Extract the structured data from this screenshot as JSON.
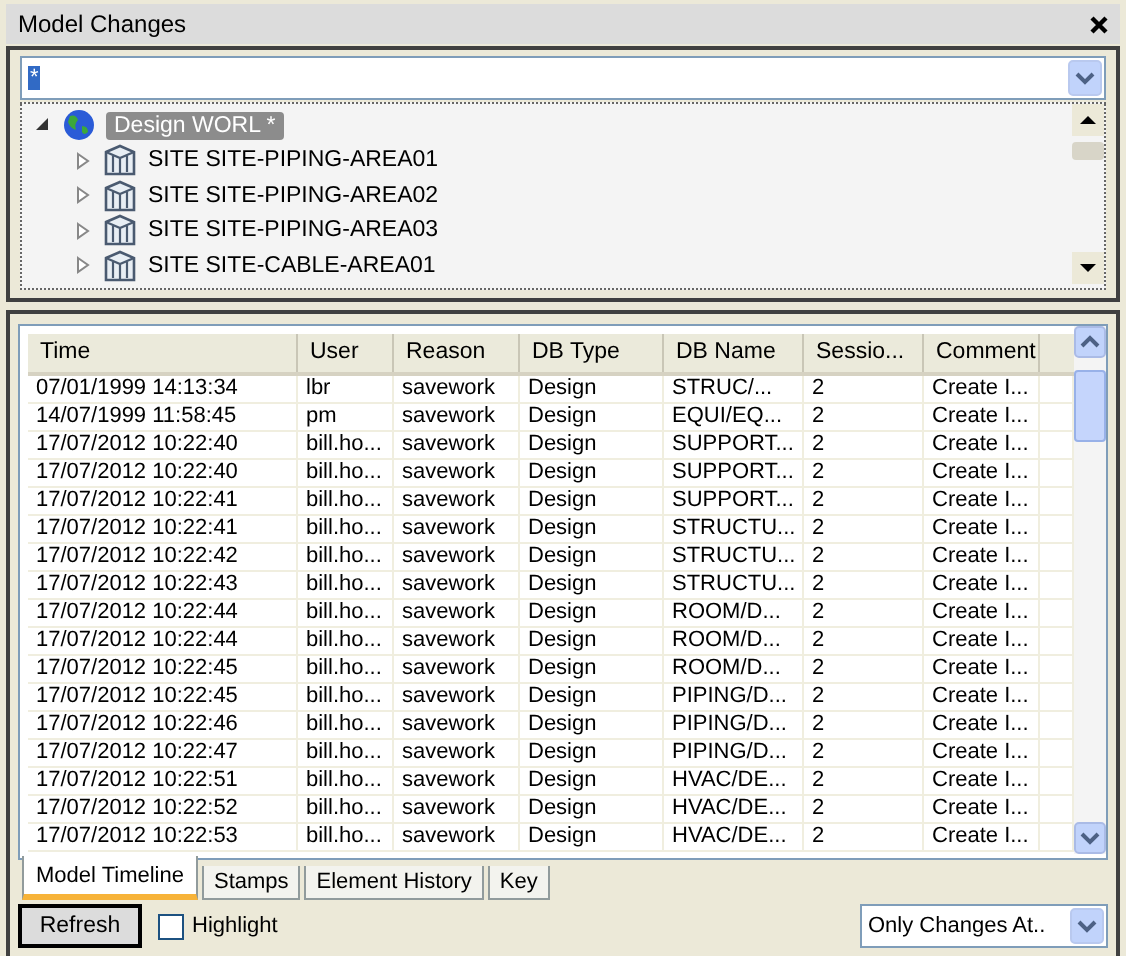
{
  "window": {
    "title": "Model Changes"
  },
  "filter": {
    "value": "*"
  },
  "tree": {
    "root": {
      "label": "Design WORL *",
      "expanded": true,
      "selected": true,
      "children": [
        {
          "label": "SITE SITE-PIPING-AREA01",
          "expanded": false
        },
        {
          "label": "SITE SITE-PIPING-AREA02",
          "expanded": false
        },
        {
          "label": "SITE SITE-PIPING-AREA03",
          "expanded": false
        },
        {
          "label": "SITE SITE-CABLE-AREA01",
          "expanded": false
        }
      ]
    }
  },
  "table": {
    "columns": [
      "Time",
      "User",
      "Reason",
      "DB Type",
      "DB Name",
      "Sessio...",
      "Comment"
    ],
    "rows": [
      [
        "07/01/1999 14:13:34",
        "lbr",
        "savework",
        "Design",
        "STRUC/...",
        "2",
        "Create I..."
      ],
      [
        "14/07/1999 11:58:45",
        "pm",
        "savework",
        "Design",
        "EQUI/EQ...",
        "2",
        "Create I..."
      ],
      [
        "17/07/2012 10:22:40",
        "bill.ho...",
        "savework",
        "Design",
        "SUPPORT...",
        "2",
        "Create I..."
      ],
      [
        "17/07/2012 10:22:40",
        "bill.ho...",
        "savework",
        "Design",
        "SUPPORT...",
        "2",
        "Create I..."
      ],
      [
        "17/07/2012 10:22:41",
        "bill.ho...",
        "savework",
        "Design",
        "SUPPORT...",
        "2",
        "Create I..."
      ],
      [
        "17/07/2012 10:22:41",
        "bill.ho...",
        "savework",
        "Design",
        "STRUCTU...",
        "2",
        "Create I..."
      ],
      [
        "17/07/2012 10:22:42",
        "bill.ho...",
        "savework",
        "Design",
        "STRUCTU...",
        "2",
        "Create I..."
      ],
      [
        "17/07/2012 10:22:43",
        "bill.ho...",
        "savework",
        "Design",
        "STRUCTU...",
        "2",
        "Create I..."
      ],
      [
        "17/07/2012 10:22:44",
        "bill.ho...",
        "savework",
        "Design",
        "ROOM/D...",
        "2",
        "Create I..."
      ],
      [
        "17/07/2012 10:22:44",
        "bill.ho...",
        "savework",
        "Design",
        "ROOM/D...",
        "2",
        "Create I..."
      ],
      [
        "17/07/2012 10:22:45",
        "bill.ho...",
        "savework",
        "Design",
        "ROOM/D...",
        "2",
        "Create I..."
      ],
      [
        "17/07/2012 10:22:45",
        "bill.ho...",
        "savework",
        "Design",
        "PIPING/D...",
        "2",
        "Create I..."
      ],
      [
        "17/07/2012 10:22:46",
        "bill.ho...",
        "savework",
        "Design",
        "PIPING/D...",
        "2",
        "Create I..."
      ],
      [
        "17/07/2012 10:22:47",
        "bill.ho...",
        "savework",
        "Design",
        "PIPING/D...",
        "2",
        "Create I..."
      ],
      [
        "17/07/2012 10:22:51",
        "bill.ho...",
        "savework",
        "Design",
        "HVAC/DE...",
        "2",
        "Create I..."
      ],
      [
        "17/07/2012 10:22:52",
        "bill.ho...",
        "savework",
        "Design",
        "HVAC/DE...",
        "2",
        "Create I..."
      ],
      [
        "17/07/2012 10:22:53",
        "bill.ho...",
        "savework",
        "Design",
        "HVAC/DE...",
        "2",
        "Create I..."
      ]
    ]
  },
  "tabs": [
    {
      "label": "Model Timeline",
      "selected": true
    },
    {
      "label": "Stamps",
      "selected": false
    },
    {
      "label": "Element History",
      "selected": false
    },
    {
      "label": "Key",
      "selected": false
    }
  ],
  "refresh_button": {
    "label": "Refresh"
  },
  "highlight": {
    "label": "Highlight",
    "checked": false
  },
  "mode_select": {
    "value": "Only Changes At.."
  }
}
